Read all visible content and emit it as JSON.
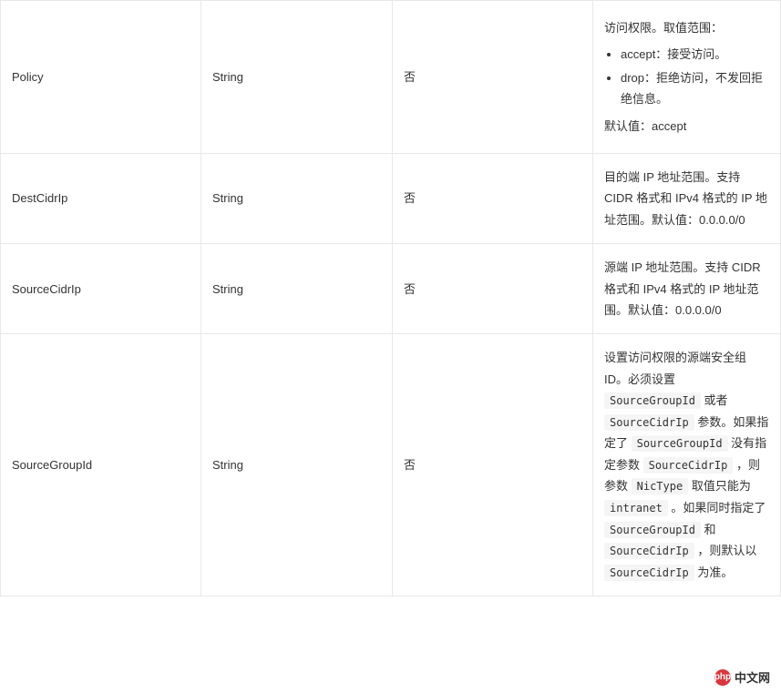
{
  "rows": [
    {
      "name": "Policy",
      "type": "String",
      "required": "否",
      "desc_intro": "访问权限。取值范围：",
      "bullets": [
        "accept：接受访问。",
        "drop：拒绝访问，不发回拒绝信息。"
      ],
      "desc_outro": "默认值：accept"
    },
    {
      "name": "DestCidrIp",
      "type": "String",
      "required": "否",
      "desc_plain": "目的端 IP 地址范围。支持 CIDR 格式和 IPv4 格式的 IP 地址范围。默认值：0.0.0.0/0"
    },
    {
      "name": "SourceCidrIp",
      "type": "String",
      "required": "否",
      "desc_plain": "源端 IP 地址范围。支持 CIDR 格式和 IPv4 格式的 IP 地址范围。默认值：0.0.0.0/0"
    },
    {
      "name": "SourceGroupId",
      "type": "String",
      "required": "否",
      "desc_rich": {
        "seg1": "设置访问权限的源端安全组 ID。必须设置 ",
        "code1": "SourceGroupId",
        "seg2": " 或者 ",
        "code2": "SourceCidrIp",
        "seg3": " 参数。如果指定了 ",
        "code3": "SourceGroupId",
        "seg4": " 没有指定参数 ",
        "code4": "SourceCidrIp",
        "seg5": " ，则参数 ",
        "code5": "NicType",
        "seg6": " 取值只能为 ",
        "code6": "intranet",
        "seg7": " 。如果同时指定了 ",
        "code7": "SourceGroupId",
        "seg8": " 和 ",
        "code8": "SourceCidrIp",
        "seg9": " ，则默认以 ",
        "code9": "SourceCidrIp",
        "seg10": " 为准。"
      }
    }
  ],
  "watermark": {
    "logo_text": "php",
    "label": "中文网"
  }
}
